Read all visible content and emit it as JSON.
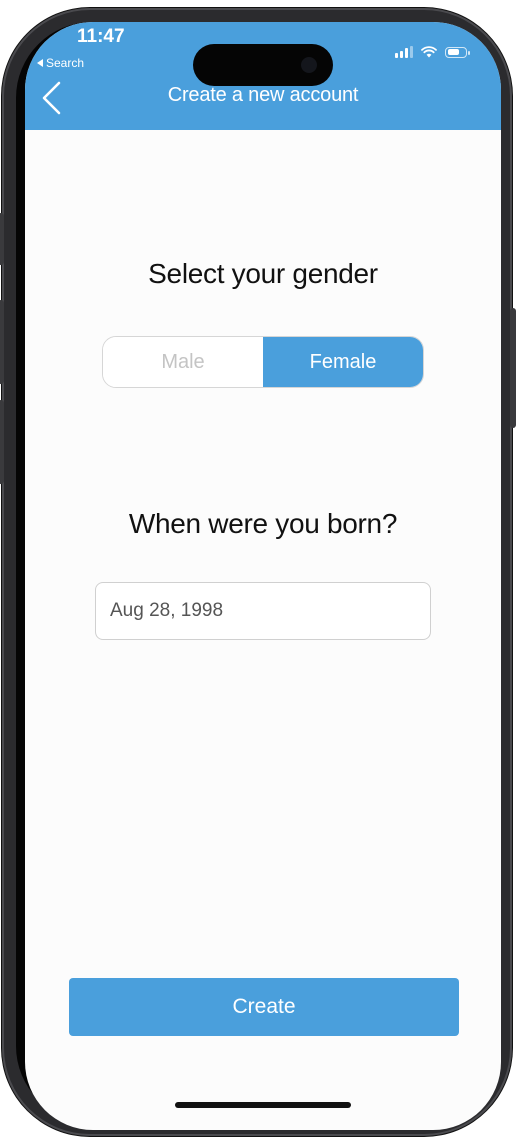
{
  "status_bar": {
    "time": "11:47",
    "back_app": "Search",
    "icons": [
      "signal-icon",
      "wifi-icon",
      "battery-icon"
    ]
  },
  "nav": {
    "back_icon": "chevron-left-icon",
    "title": "Create a new account"
  },
  "gender": {
    "title": "Select your gender",
    "options": [
      "Male",
      "Female"
    ],
    "selected": "Female"
  },
  "birth": {
    "title": "When were you born?",
    "date_value": "Aug 28, 1998"
  },
  "actions": {
    "create_label": "Create"
  },
  "colors": {
    "accent": "#4a9fdc",
    "header": "#4a9fdc",
    "text": "#111111",
    "muted": "#c4c4c4"
  }
}
